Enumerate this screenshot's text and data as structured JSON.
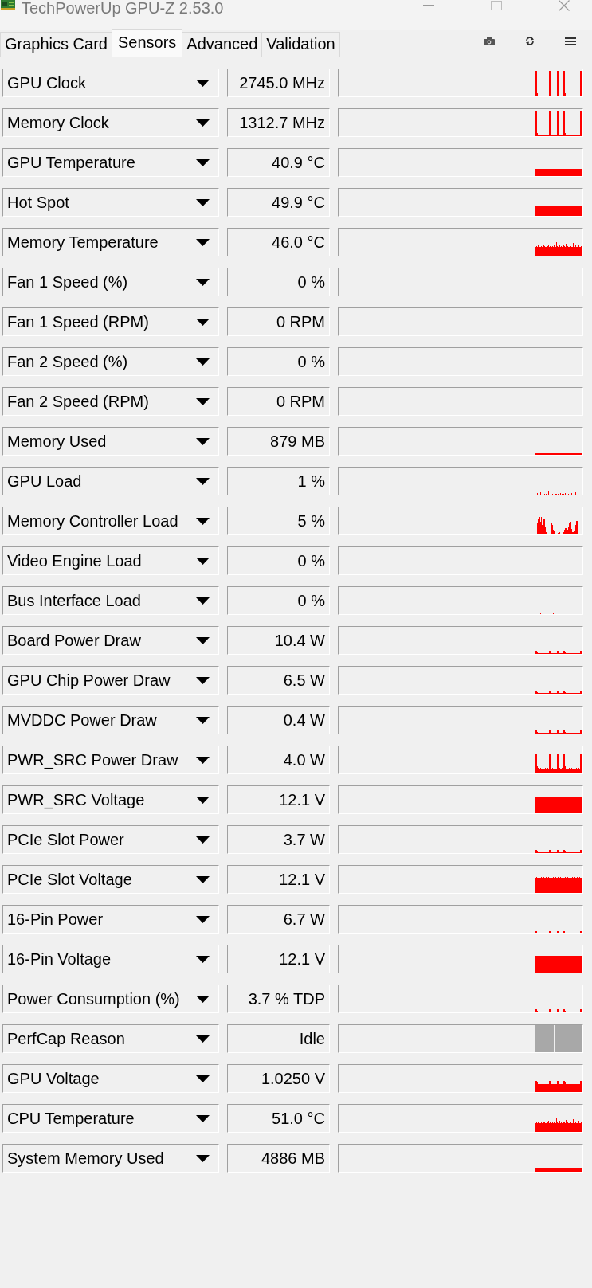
{
  "window": {
    "title": "TechPowerUp GPU-Z 2.53.0"
  },
  "tabs": [
    {
      "label": "Graphics Card",
      "selected": false
    },
    {
      "label": "Sensors",
      "selected": true
    },
    {
      "label": "Advanced",
      "selected": false
    },
    {
      "label": "Validation",
      "selected": false
    }
  ],
  "sensors": [
    {
      "name": "GPU Clock",
      "value": "2745.0 MHz",
      "kind": "spikes"
    },
    {
      "name": "Memory Clock",
      "value": "1312.7 MHz",
      "kind": "spikes"
    },
    {
      "name": "GPU Temperature",
      "value": "40.9 °C",
      "kind": "low"
    },
    {
      "name": "Hot Spot",
      "value": "49.9 °C",
      "kind": "mid"
    },
    {
      "name": "Memory Temperature",
      "value": "46.0 °C",
      "kind": "noisy"
    },
    {
      "name": "Fan 1 Speed (%)",
      "value": "0 %",
      "kind": "empty"
    },
    {
      "name": "Fan 1 Speed (RPM)",
      "value": "0 RPM",
      "kind": "empty"
    },
    {
      "name": "Fan 2 Speed (%)",
      "value": "0 %",
      "kind": "empty"
    },
    {
      "name": "Fan 2 Speed (RPM)",
      "value": "0 RPM",
      "kind": "empty"
    },
    {
      "name": "Memory Used",
      "value": "879 MB",
      "kind": "line"
    },
    {
      "name": "GPU Load",
      "value": "1 %",
      "kind": "specks"
    },
    {
      "name": "Memory Controller Load",
      "value": "5 %",
      "kind": "bursts"
    },
    {
      "name": "Video Engine Load",
      "value": "0 %",
      "kind": "empty"
    },
    {
      "name": "Bus Interface Load",
      "value": "0 %",
      "kind": "dots"
    },
    {
      "name": "Board Power Draw",
      "value": "10.4 W",
      "kind": "blips"
    },
    {
      "name": "GPU Chip Power Draw",
      "value": "6.5 W",
      "kind": "blips"
    },
    {
      "name": "MVDDC Power Draw",
      "value": "0.4 W",
      "kind": "blips"
    },
    {
      "name": "PWR_SRC Power Draw",
      "value": "4.0 W",
      "kind": "surges"
    },
    {
      "name": "PWR_SRC Voltage",
      "value": "12.1 V",
      "kind": "high"
    },
    {
      "name": "PCIe Slot Power",
      "value": "3.7 W",
      "kind": "blips"
    },
    {
      "name": "PCIe Slot Voltage",
      "value": "12.1 V",
      "kind": "choppy"
    },
    {
      "name": "16-Pin Power",
      "value": "6.7 W",
      "kind": "ticks"
    },
    {
      "name": "16-Pin Voltage",
      "value": "12.1 V",
      "kind": "high"
    },
    {
      "name": "Power Consumption (%)",
      "value": "3.7 % TDP",
      "kind": "blips"
    },
    {
      "name": "PerfCap Reason",
      "value": "Idle",
      "kind": "grey"
    },
    {
      "name": "GPU Voltage",
      "value": "1.0250 V",
      "kind": "raised"
    },
    {
      "name": "CPU Temperature",
      "value": "51.0 °C",
      "kind": "noisy"
    },
    {
      "name": "System Memory Used",
      "value": "4886 MB",
      "kind": "thin"
    }
  ]
}
